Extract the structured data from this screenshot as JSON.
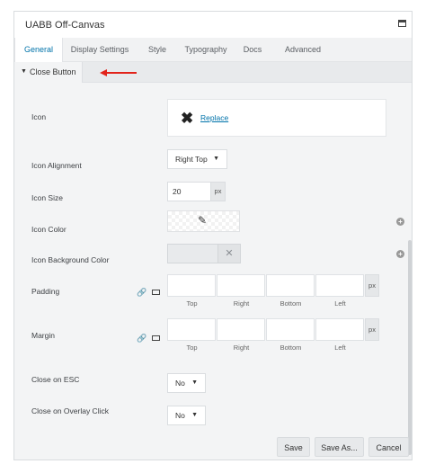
{
  "window": {
    "title": "UABB Off-Canvas"
  },
  "tabs": [
    {
      "label": "General",
      "active": true
    },
    {
      "label": "Display Settings"
    },
    {
      "label": "Style"
    },
    {
      "label": "Typography"
    },
    {
      "label": "Docs"
    },
    {
      "label": "Advanced"
    }
  ],
  "section": {
    "label": "Close Button",
    "collapsed": false
  },
  "fields": {
    "icon": {
      "label": "Icon",
      "glyph": "✖",
      "action": "Replace"
    },
    "icon_alignment": {
      "label": "Icon Alignment",
      "value": "Right Top"
    },
    "icon_size": {
      "label": "Icon Size",
      "value": "20",
      "unit": "px"
    },
    "icon_color": {
      "label": "Icon Color"
    },
    "icon_bg_color": {
      "label": "Icon Background Color"
    },
    "padding": {
      "label": "Padding",
      "unit": "px",
      "sides": [
        "Top",
        "Right",
        "Bottom",
        "Left"
      ]
    },
    "margin": {
      "label": "Margin",
      "unit": "px",
      "sides": [
        "Top",
        "Right",
        "Bottom",
        "Left"
      ]
    },
    "close_on_esc": {
      "label": "Close on ESC",
      "value": "No"
    },
    "close_on_overlay": {
      "label": "Close on Overlay Click",
      "value": "No"
    }
  },
  "buttons": {
    "save": "Save",
    "save_as": "Save As...",
    "cancel": "Cancel"
  },
  "colors": {
    "accent": "#0073aa",
    "annotation_arrow": "#e2231a"
  }
}
